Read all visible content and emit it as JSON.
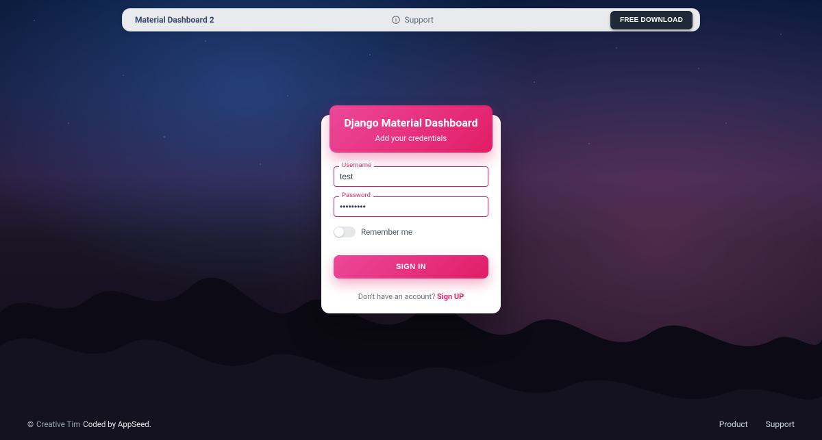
{
  "navbar": {
    "brand": "Material Dashboard 2",
    "support_label": "Support",
    "download_label": "FREE DOWNLOAD"
  },
  "card": {
    "title": "Django Material Dashboard",
    "subtitle": "Add your credentials",
    "username_label": "Username",
    "username_value": "test",
    "password_label": "Password",
    "password_value": "•••••••••",
    "remember_label": "Remember me",
    "signin_label": "SIGN IN",
    "signup_prompt": "Don't have an account? ",
    "signup_link": "Sign UP"
  },
  "footer": {
    "copyright_symbol": "©",
    "creative_tim": "Creative Tim",
    "coded_by": " Coded by AppSeed.",
    "links": {
      "product": "Product",
      "support": "Support"
    }
  },
  "colors": {
    "accent": "#e11d66"
  }
}
